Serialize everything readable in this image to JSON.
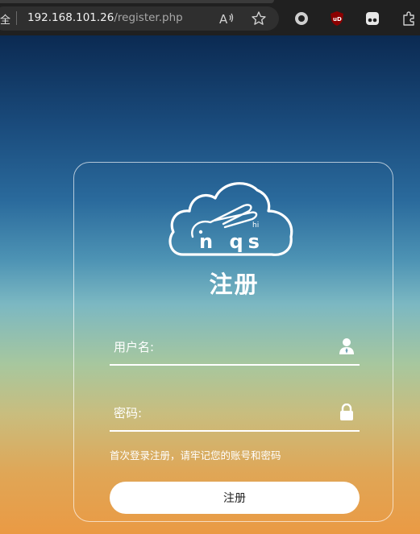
{
  "browser": {
    "address_prefix": "全",
    "url_host": "192.168.101.26",
    "url_path": "/register.php",
    "icons": [
      "read-aloud-icon",
      "favorite-star-icon",
      "circle-extension-icon",
      "ublock-origin-icon",
      "extension-face-icon",
      "extensions-puzzle-icon"
    ],
    "ublock_badge": "uD"
  },
  "register": {
    "logo": {
      "small_text": "hi",
      "brand_text": "n qs"
    },
    "title": "注册",
    "username_label": "用户名:",
    "password_label": "密码:",
    "hint": "首次登录注册，请牢记您的账号和密码",
    "submit_label": "注册"
  },
  "colors": {
    "background_top": "#0b2a52",
    "background_bottom": "#ea9a44",
    "chrome": "#202020",
    "text": "#ffffff"
  }
}
